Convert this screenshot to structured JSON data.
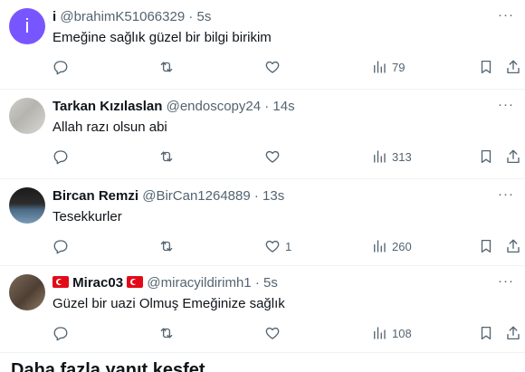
{
  "replies": [
    {
      "avatar_letter": "i",
      "display_name": "i",
      "handle": "@brahimK51066329",
      "time": "5s",
      "text": "Emeğine sağlık güzel bir bilgi birikim",
      "replies": "",
      "retweets": "",
      "likes": "",
      "views": "79"
    },
    {
      "display_name": "Tarkan Kızılaslan",
      "handle": "@endoscopy24",
      "time": "14s",
      "text": "Allah razı olsun abi",
      "replies": "",
      "retweets": "",
      "likes": "",
      "views": "313"
    },
    {
      "display_name": "Bircan Remzi",
      "handle": "@BirCan1264889",
      "time": "13s",
      "text": "Tesekkurler",
      "replies": "",
      "retweets": "",
      "likes": "1",
      "views": "260"
    },
    {
      "display_name": "Mirac03",
      "handle": "@miracyildirimh1",
      "time": "5s",
      "text": "Güzel bir uazi Olmuş Emeğinize sağlık",
      "replies": "",
      "retweets": "",
      "likes": "",
      "views": "108"
    }
  ],
  "separator": "·",
  "more_label": "···",
  "bottom_heading": "Daha fazla yanıt keşfet",
  "icons": {
    "reply": "reply-icon",
    "retweet": "retweet-icon",
    "like": "heart-icon",
    "views": "views-chart-icon",
    "bookmark": "bookmark-icon",
    "share": "share-icon",
    "flag": "turkey-flag-icon"
  },
  "colors": {
    "avatar_letter_bg": "#7856ff",
    "text_primary": "#0f1419",
    "text_secondary": "#536471",
    "divider": "#eff3f4",
    "flag_red": "#e30a17"
  }
}
